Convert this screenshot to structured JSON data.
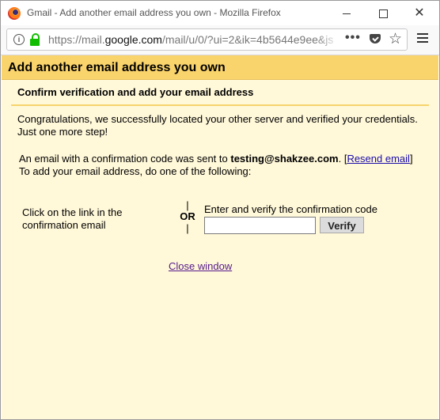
{
  "window": {
    "title": "Gmail - Add another email address you own - Mozilla Firefox"
  },
  "urlbar": {
    "url_prefix": "https://mail.",
    "url_domain": "google.com",
    "url_suffix": "/mail/u/0/?ui=2&ik=4b5644e9ee&js"
  },
  "header": {
    "title": "Add another email address you own"
  },
  "section": {
    "heading": "Confirm verification and add your email address",
    "congrats": "Congratulations, we successfully located your other server and verified your credentials. Just one more step!",
    "sent_prefix": "An email with a confirmation code was sent to ",
    "email": "testing@shakzee.com",
    "sent_after_email": ". [",
    "resend_link": "Resend email",
    "sent_close_bracket": "]",
    "instruction": "To add your email address, do one of the following:"
  },
  "options": {
    "left_text": "Click on the link in the confirmation email",
    "or_bar": "|",
    "or_label": "OR",
    "right_label": "Enter and verify the confirmation code",
    "code_value": "",
    "verify_label": "Verify"
  },
  "footer": {
    "close_link": "Close window"
  },
  "colors": {
    "header_bg": "#f9d36b",
    "content_bg": "#fff8d9",
    "link": "#1a0dab",
    "visited_link": "#551a8b"
  }
}
